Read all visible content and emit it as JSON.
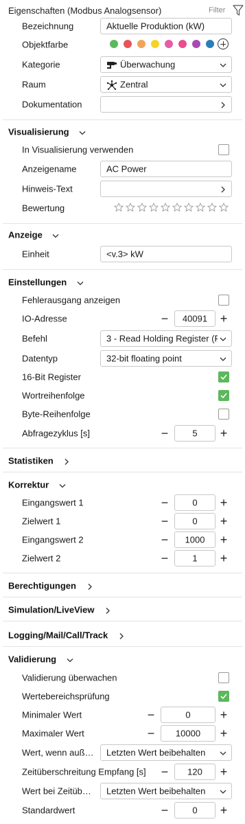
{
  "header": {
    "title": "Eigenschaften (Modbus Analogsensor)",
    "filter_label": "Filter",
    "filter_icon": "funnel-icon"
  },
  "general": {
    "bezeichnung_label": "Bezeichnung",
    "bezeichnung_value": "Aktuelle Produktion (kW)",
    "objektfarbe_label": "Objektfarbe",
    "colors": [
      "#5cb85c",
      "#e8525a",
      "#f0a35a",
      "#f5d327",
      "#e45ea6",
      "#e84e8e",
      "#a94ab1",
      "#2b7fb8"
    ],
    "kategorie_label": "Kategorie",
    "kategorie_value": "Überwachung",
    "kategorie_icon": "security-camera-icon",
    "raum_label": "Raum",
    "raum_value": "Zentral",
    "raum_icon": "hub-icon",
    "dokumentation_label": "Dokumentation",
    "dokumentation_value": ""
  },
  "visualisierung": {
    "title": "Visualisierung",
    "use_label": "In Visualisierung verwenden",
    "use_checked": false,
    "anzeigename_label": "Anzeigename",
    "anzeigename_value": "AC Power",
    "hinweis_label": "Hinweis-Text",
    "hinweis_value": "",
    "bewertung_label": "Bewertung",
    "stars_total": 10,
    "stars_filled": 0
  },
  "anzeige": {
    "title": "Anzeige",
    "einheit_label": "Einheit",
    "einheit_value": "<v.3> kW"
  },
  "einstellungen": {
    "title": "Einstellungen",
    "fehler_label": "Fehlerausgang anzeigen",
    "fehler_checked": false,
    "io_label": "IO-Adresse",
    "io_value": "40091",
    "befehl_label": "Befehl",
    "befehl_value": "3 - Read Holding Register (F",
    "datentyp_label": "Datentyp",
    "datentyp_value": "32-bit floating point",
    "reg16_label": "16-Bit Register",
    "reg16_checked": true,
    "wort_label": "Wortreihenfolge",
    "wort_checked": true,
    "byte_label": "Byte-Reihenfolge",
    "byte_checked": false,
    "zyklus_label": "Abfragezyklus [s]",
    "zyklus_value": "5"
  },
  "statistiken": {
    "title": "Statistiken"
  },
  "korrektur": {
    "title": "Korrektur",
    "in1_label": "Eingangswert 1",
    "in1_value": "0",
    "ziel1_label": "Zielwert 1",
    "ziel1_value": "0",
    "in2_label": "Eingangswert 2",
    "in2_value": "1000",
    "ziel2_label": "Zielwert 2",
    "ziel2_value": "1"
  },
  "berechtigungen": {
    "title": "Berechtigungen"
  },
  "simulation": {
    "title": "Simulation/LiveView"
  },
  "logging": {
    "title": "Logging/Mail/Call/Track"
  },
  "validierung": {
    "title": "Validierung",
    "ueberwachen_label": "Validierung überwachen",
    "ueberwachen_checked": false,
    "bereich_label": "Wertebereichsprüfung",
    "bereich_checked": true,
    "min_label": "Minimaler Wert",
    "min_value": "0",
    "max_label": "Maximaler Wert",
    "max_value": "10000",
    "wennaus_label": "Wert, wenn auß…",
    "wennaus_value": "Letzten Wert beibehalten",
    "timeout_label": "Zeitüberschreitung Empfang [s]",
    "timeout_value": "120",
    "beitimeout_label": "Wert bei Zeitüb…",
    "beitimeout_value": "Letzten Wert beibehalten",
    "standard_label": "Standardwert",
    "standard_value": "0"
  },
  "icons": {
    "minus": "−",
    "plus": "+",
    "chevron_down": "chevron-down-icon",
    "chevron_right": "chevron-right-icon"
  }
}
